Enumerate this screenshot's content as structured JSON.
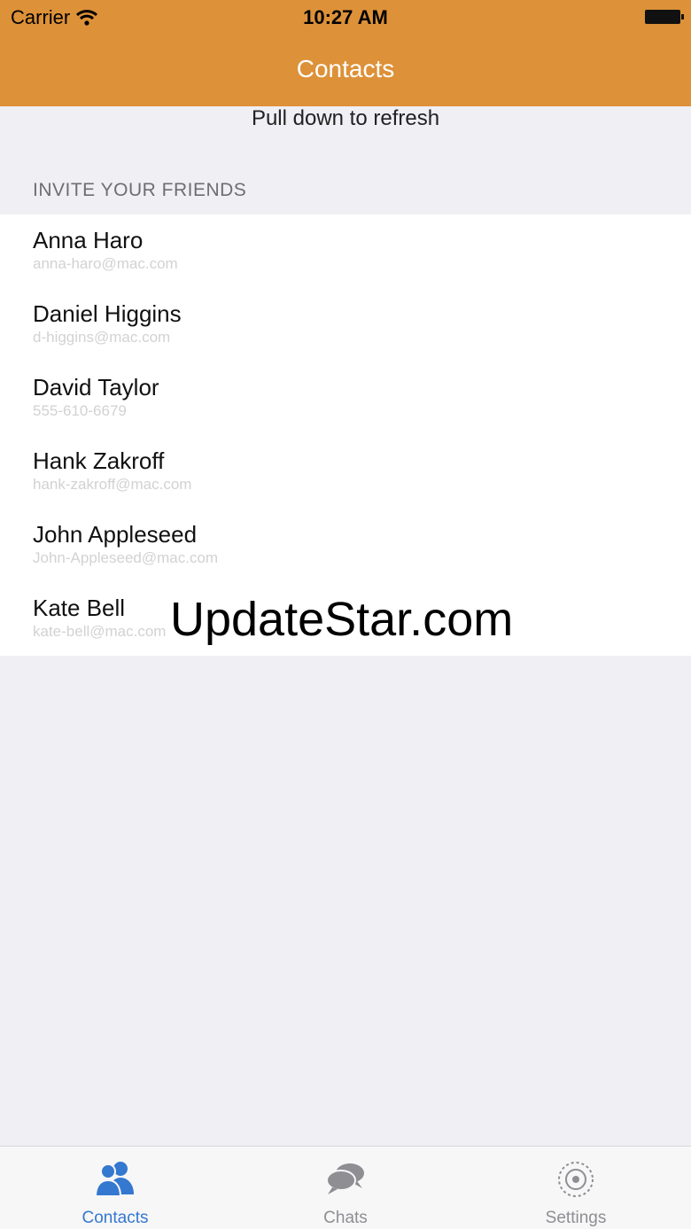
{
  "status_bar": {
    "carrier": "Carrier",
    "time": "10:27 AM",
    "wifi_icon": "wifi-icon",
    "battery_icon": "battery-icon"
  },
  "nav": {
    "title": "Contacts"
  },
  "pull_to_refresh": "Pull down to refresh",
  "section": {
    "title": "INVITE YOUR FRIENDS"
  },
  "contacts": [
    {
      "name": "Anna Haro",
      "detail": "anna-haro@mac.com"
    },
    {
      "name": "Daniel Higgins",
      "detail": "d-higgins@mac.com"
    },
    {
      "name": "David Taylor",
      "detail": "555-610-6679"
    },
    {
      "name": "Hank Zakroff",
      "detail": "hank-zakroff@mac.com"
    },
    {
      "name": "John Appleseed",
      "detail": "John-Appleseed@mac.com"
    },
    {
      "name": "Kate Bell",
      "detail": "kate-bell@mac.com"
    }
  ],
  "watermark": "UpdateStar.com",
  "tabs": [
    {
      "label": "Contacts",
      "icon": "contacts-icon",
      "active": true
    },
    {
      "label": "Chats",
      "icon": "chats-icon",
      "active": false
    },
    {
      "label": "Settings",
      "icon": "settings-icon",
      "active": false
    }
  ],
  "colors": {
    "header": "#dd9138",
    "background": "#efeff4",
    "active_tab": "#3478d0",
    "inactive_tab": "#8e8e93"
  }
}
